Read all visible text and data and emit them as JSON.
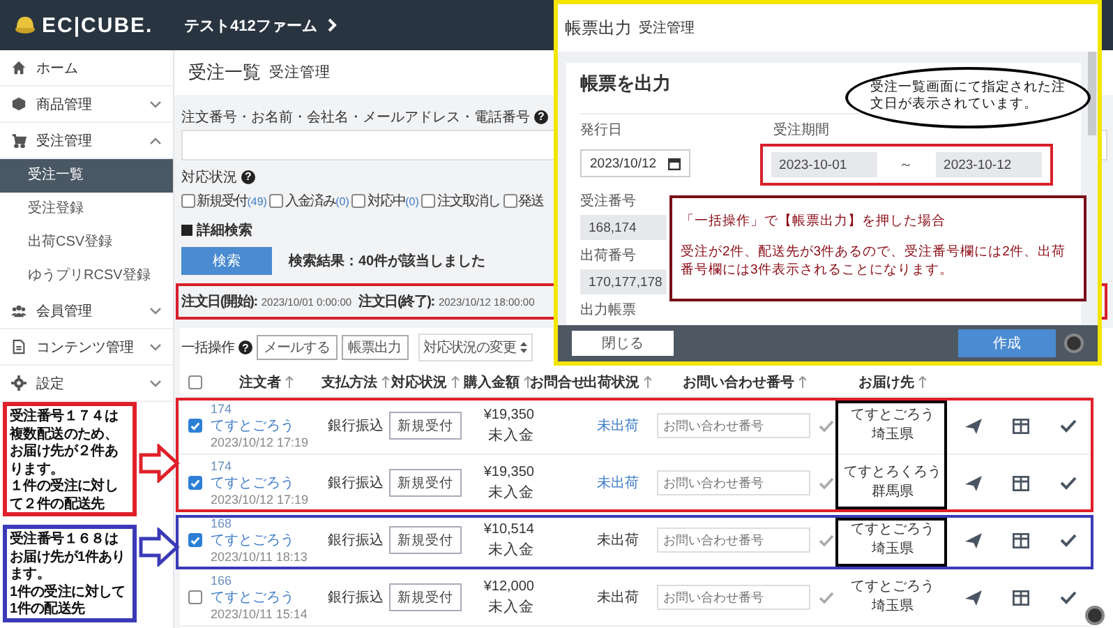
{
  "header": {
    "logo": "EC|CUBE.",
    "shop": "テスト412ファーム"
  },
  "sidebar": {
    "items": [
      {
        "label": "ホーム"
      },
      {
        "label": "商品管理",
        "expanded": false
      },
      {
        "label": "受注管理",
        "expanded": true,
        "children": [
          {
            "label": "受注一覧",
            "selected": true
          },
          {
            "label": "受注登録",
            "selected": false
          },
          {
            "label": "出荷CSV登録",
            "selected": false
          },
          {
            "label": "ゆうプリRCSV登録",
            "selected": false
          }
        ]
      },
      {
        "label": "会員管理",
        "expanded": false
      },
      {
        "label": "コンテンツ管理",
        "expanded": false
      },
      {
        "label": "設定",
        "expanded": false
      }
    ]
  },
  "page": {
    "title": "受注一覧",
    "subtitle": "受注管理"
  },
  "search": {
    "label": "注文番号・お名前・会社名・メールアドレス・電話番号",
    "help": "?",
    "status_label": "対応状況",
    "status_help": "?",
    "statuses": [
      {
        "label": "新規受付",
        "count": "(49)",
        "checked": false
      },
      {
        "label": "入金済み",
        "count": "(0)",
        "checked": false
      },
      {
        "label": "対応中",
        "count": "(0)",
        "checked": false
      },
      {
        "label": "注文取消し",
        "checked": false
      },
      {
        "label": "発送",
        "checked": false
      }
    ],
    "detail": "詳細検索",
    "button": "検索",
    "result": "検索結果：40件が該当しました"
  },
  "filter_summary": [
    {
      "label": "注文日(開始):",
      "value": "2023/10/01 0:00:00"
    },
    {
      "label": "注文日(終了):",
      "value": "2023/10/12 18:00:00"
    }
  ],
  "bulk": {
    "label": "一括操作",
    "help": "?",
    "buttons": [
      "メールする",
      "帳票出力"
    ],
    "select": "対応状況の変更"
  },
  "table": {
    "columns": [
      {
        "label": "注文者",
        "sortable": true
      },
      {
        "label": "支払方法",
        "sortable": true
      },
      {
        "label": "対応状況",
        "sortable": true
      },
      {
        "label": "購入金額",
        "sortable": true
      },
      {
        "label": "お問合せ",
        "sortable": false
      },
      {
        "label": "出荷状況",
        "sortable": true
      },
      {
        "label": "お問い合わせ番号",
        "sortable": true
      },
      {
        "label": "お届け先",
        "sortable": true
      }
    ],
    "all_checked": false,
    "rows": [
      {
        "checked": true,
        "order_no": "174",
        "customer": "てすとごろう",
        "date": "2023/10/12 17:19",
        "payment": "銀行振込",
        "status": "新規受付",
        "amount": "¥19,350",
        "payment_status": "未入金",
        "shipping": "未出荷",
        "shipping_link": true,
        "tracking_placeholder": "お問い合わせ番号",
        "dest_name": "てすとごろう",
        "dest_pref": "埼玉県"
      },
      {
        "checked": true,
        "order_no": "174",
        "customer": "てすとごろう",
        "date": "2023/10/12 17:19",
        "payment": "銀行振込",
        "status": "新規受付",
        "amount": "¥19,350",
        "payment_status": "未入金",
        "shipping": "未出荷",
        "shipping_link": true,
        "tracking_placeholder": "お問い合わせ番号",
        "dest_name": "てすとろくろう",
        "dest_pref": "群馬県"
      },
      {
        "checked": true,
        "order_no": "168",
        "customer": "てすとごろう",
        "date": "2023/10/11 18:13",
        "payment": "銀行振込",
        "status": "新規受付",
        "amount": "¥10,514",
        "payment_status": "未入金",
        "shipping": "未出荷",
        "shipping_link": false,
        "tracking_placeholder": "お問い合わせ番号",
        "dest_name": "てすとごろう",
        "dest_pref": "埼玉県"
      },
      {
        "checked": false,
        "order_no": "166",
        "customer": "てすとごろう",
        "date": "2023/10/11 15:14",
        "payment": "銀行振込",
        "status": "新規受付",
        "amount": "¥12,000",
        "payment_status": "未入金",
        "shipping": "未出荷",
        "shipping_link": false,
        "tracking_placeholder": "お問い合わせ番号",
        "dest_name": "てすとごろう",
        "dest_pref": "埼玉県"
      }
    ]
  },
  "modal": {
    "title": "帳票出力",
    "subtitle": "受注管理",
    "card_title": "帳票を出力",
    "issue_date": {
      "label": "発行日",
      "value": "2023/10/12"
    },
    "period": {
      "label": "受注期間",
      "from": "2023-10-01",
      "separator": "～",
      "to": "2023-10-12"
    },
    "order_numbers": {
      "label": "受注番号",
      "value": "168,174"
    },
    "shipping_numbers": {
      "label": "出荷番号",
      "value": "170,177,178"
    },
    "output_label": "出力帳票",
    "close": "閉じる",
    "create": "作成"
  },
  "annotations": {
    "bubble": "受注一覧画面にて指定された注文日が表示されています。",
    "note_title": "「一括操作」で【帳票出力】を押した場合",
    "note_body": "受注が2件、配送先が3件あるので、受注番号欄には2件、出荷番号欄には3件表示されることになります。",
    "row_notes": [
      {
        "lines": [
          "受注番号１７４は複数配送のため、お届け先が２件あります。",
          "１件の受注に対して２件の配送先"
        ],
        "color": "#e0202a"
      },
      {
        "lines": [
          "受注番号１６８はお届け先が1件あります。",
          "1件の受注に対して1件の配送先"
        ],
        "color": "#3a3ab8"
      }
    ]
  }
}
